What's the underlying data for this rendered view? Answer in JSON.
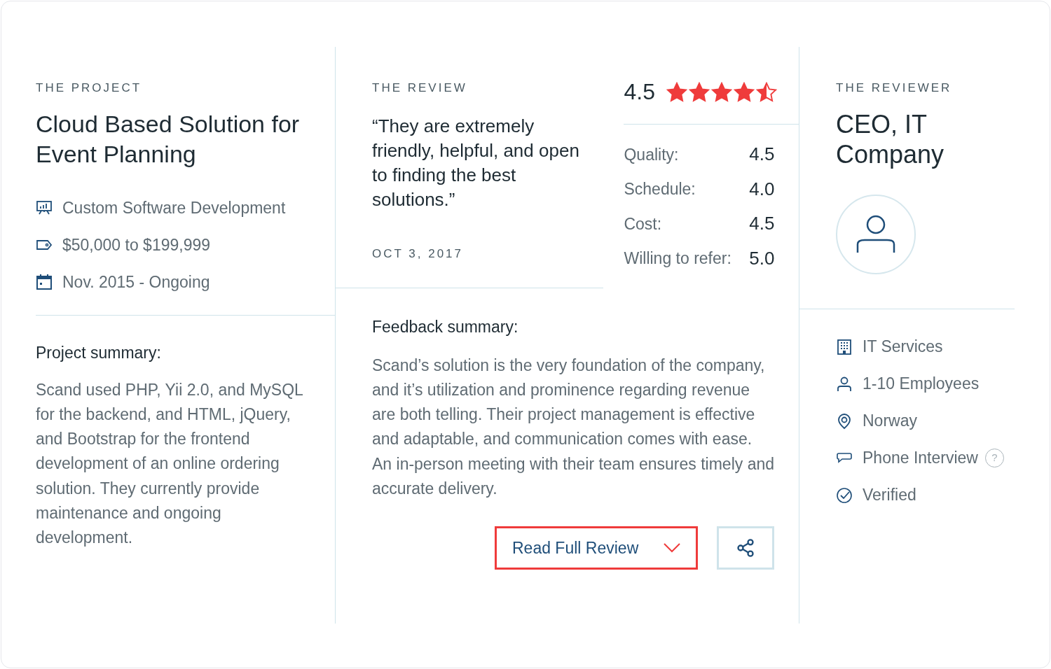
{
  "project": {
    "label": "THE PROJECT",
    "title": "Cloud Based Solution for Event Planning",
    "facts": [
      {
        "kind": "service",
        "text": "Custom Software Development"
      },
      {
        "kind": "budget",
        "text": "$50,000 to $199,999"
      },
      {
        "kind": "dates",
        "text": "Nov. 2015 - Ongoing"
      }
    ],
    "summary_heading": "Project summary:",
    "summary": "Scand used PHP, Yii 2.0, and MySQL for the backend, and HTML, jQuery, and Bootstrap for the frontend development of an online ordering solution. They currently provide maintenance and ongoing development."
  },
  "review": {
    "label": "THE REVIEW",
    "quote": "“They are extremely friendly, helpful, and open to finding the best solutions.”",
    "date": "OCT 3, 2017",
    "overall": "4.5",
    "stars": 4.5,
    "scores": [
      {
        "label": "Quality:",
        "value": "4.5"
      },
      {
        "label": "Schedule:",
        "value": "4.0"
      },
      {
        "label": "Cost:",
        "value": "4.5"
      },
      {
        "label": "Willing to refer:",
        "value": "5.0"
      }
    ],
    "feedback_heading": "Feedback summary:",
    "feedback": "Scand’s solution is the very foundation of the company, and it’s utilization and prominence regarding revenue are both telling. Their project management is effective and adaptable, and communication comes with ease. An in-person meeting with their team ensures timely and accurate delivery.",
    "read_button": "Read Full Review"
  },
  "reviewer": {
    "label": "THE REVIEWER",
    "title": "CEO, IT Company",
    "facts": [
      {
        "kind": "industry",
        "text": "IT Services"
      },
      {
        "kind": "size",
        "text": "1-10 Employees"
      },
      {
        "kind": "location",
        "text": "Norway"
      },
      {
        "kind": "interview",
        "text": "Phone Interview",
        "help": "?"
      },
      {
        "kind": "verified",
        "text": "Verified"
      }
    ]
  }
}
